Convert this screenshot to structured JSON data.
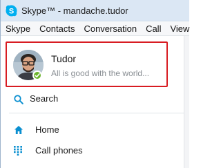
{
  "window": {
    "title": "Skype™ - mandache.tudor",
    "app_icon": "skype-icon"
  },
  "menubar": {
    "items": [
      "Skype",
      "Contacts",
      "Conversation",
      "Call",
      "View"
    ]
  },
  "profile": {
    "name": "Tudor",
    "mood": "All is good with the world...",
    "status": "online",
    "status_color": "#6bb42b",
    "highlight_color": "#d81c22"
  },
  "search": {
    "label": "Search",
    "icon": "search-icon"
  },
  "nav": {
    "items": [
      {
        "label": "Home",
        "icon": "home-icon"
      },
      {
        "label": "Call phones",
        "icon": "dialpad-icon"
      }
    ]
  },
  "colors": {
    "accent": "#00aff0",
    "titlebar": "#dbe7f4"
  }
}
